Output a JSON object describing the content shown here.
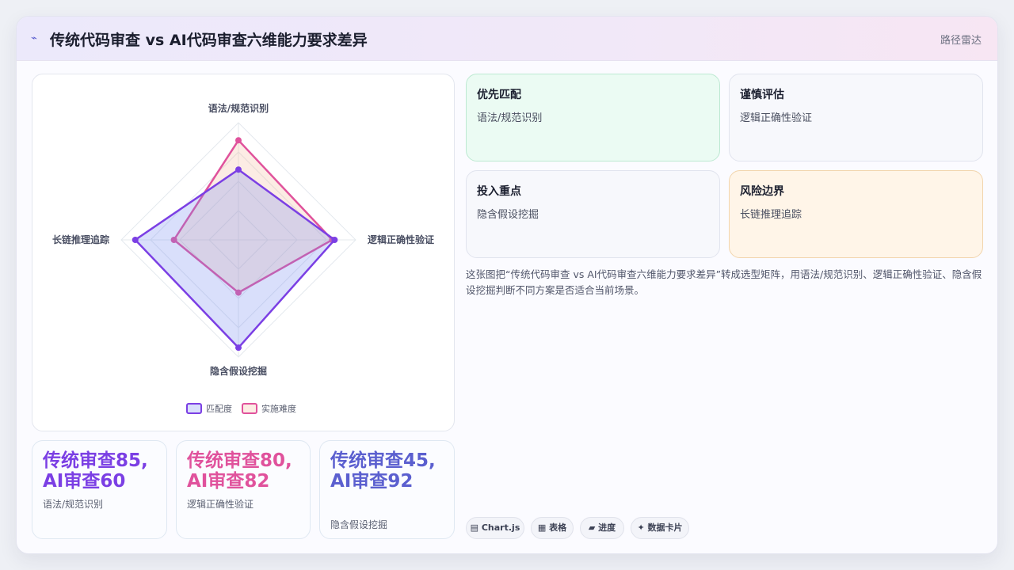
{
  "header": {
    "icon": "chart-icon",
    "title": "传统代码审查 vs AI代码审查六维能力要求差异",
    "tag": "路径雷达"
  },
  "chart_data": {
    "type": "radar",
    "axes": [
      "语法/规范识别",
      "逻辑正确性验证",
      "隐含假设挖掘",
      "长链推理追踪"
    ],
    "max": 100,
    "series": [
      {
        "name": "匹配度",
        "color": "#7b3fe4",
        "fill": "rgba(120,140,240,0.28)",
        "values": [
          60,
          82,
          92,
          88
        ]
      },
      {
        "name": "实施难度",
        "color": "#e0529c",
        "fill": "rgba(240,170,130,0.22)",
        "values": [
          85,
          80,
          45,
          55
        ]
      }
    ]
  },
  "stats": [
    {
      "value": "传统审查85, AI审查60",
      "label": "语法/规范识别",
      "color": "#7b3fe4"
    },
    {
      "value": "传统审查80, AI审查82",
      "label": "逻辑正确性验证",
      "color": "#e0529c"
    },
    {
      "value": "传统审查45, AI审查92",
      "label": "隐含假设挖掘",
      "color": "#5b5fcf"
    }
  ],
  "cards": [
    {
      "title": "优先匹配",
      "value": "语法/规范识别"
    },
    {
      "title": "谨慎评估",
      "value": "逻辑正确性验证"
    },
    {
      "title": "投入重点",
      "value": "隐含假设挖掘"
    },
    {
      "title": "风险边界",
      "value": "长链推理追踪"
    }
  ],
  "description": "这张图把“传统代码审查 vs AI代码审查六维能力要求差异”转成选型矩阵，用语法/规范识别、逻辑正确性验证、隐含假设挖掘判断不同方案是否适合当前场景。",
  "chips": [
    {
      "icon": "chart-icon",
      "label": "Chart.js"
    },
    {
      "icon": "table-icon",
      "label": "表格"
    },
    {
      "icon": "progress-icon",
      "label": "进度"
    },
    {
      "icon": "sparkle-icon",
      "label": "数据卡片"
    }
  ]
}
